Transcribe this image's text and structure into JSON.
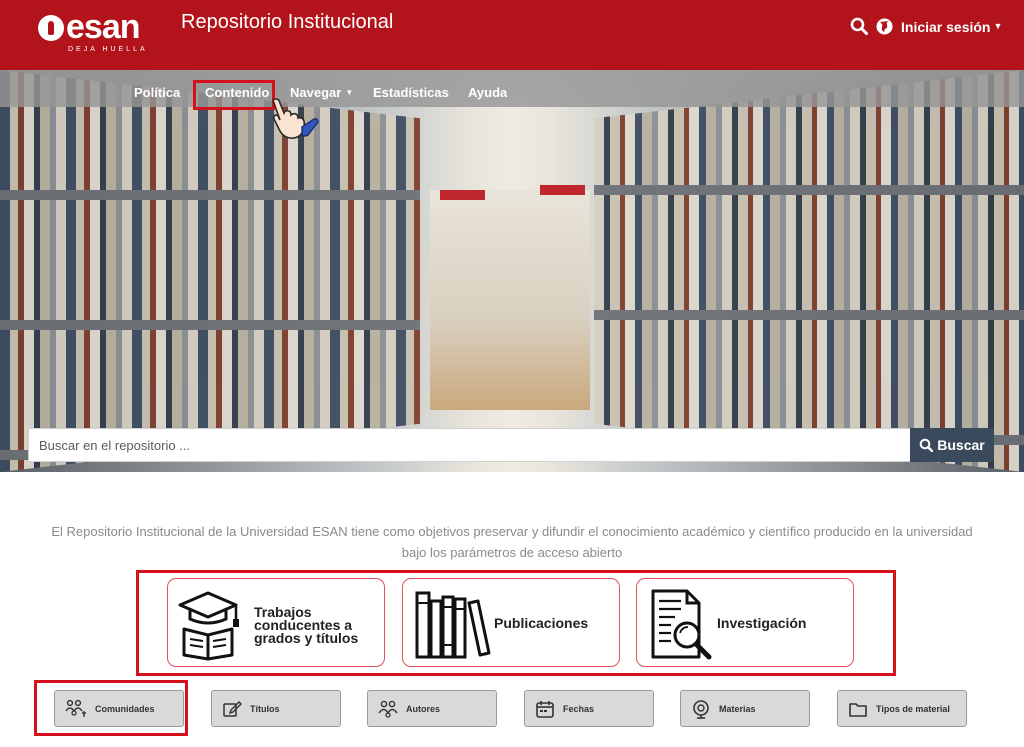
{
  "header": {
    "logo_text": "esan",
    "logo_tagline": "DEJA HUELLA",
    "title": "Repositorio Institucional",
    "login_label": "Iniciar sesión"
  },
  "nav": {
    "items": [
      {
        "label": "Política"
      },
      {
        "label": "Contenido"
      },
      {
        "label": "Navegar"
      },
      {
        "label": "Estadísticas"
      },
      {
        "label": "Ayuda"
      }
    ]
  },
  "search": {
    "placeholder": "Buscar en el repositorio ...",
    "button_label": "Buscar"
  },
  "description": "El Repositorio Institucional de la Universidad ESAN tiene como objetivos preservar y difundir el conocimiento académico y científico producido en la universidad bajo los parámetros de acceso abierto",
  "cards": [
    {
      "label_lines": [
        "Trabajos",
        "conducentes a",
        "grados y títulos"
      ]
    },
    {
      "label": "Publicaciones"
    },
    {
      "label": "Investigación"
    }
  ],
  "browse": [
    {
      "label": "Comunidades",
      "icon": "community-icon"
    },
    {
      "label": "Títulos",
      "icon": "edit-icon"
    },
    {
      "label": "Autores",
      "icon": "authors-icon"
    },
    {
      "label": "Fechas",
      "icon": "calendar-icon"
    },
    {
      "label": "Materias",
      "icon": "monitor-icon"
    },
    {
      "label": "Tipos de material",
      "icon": "folder-icon"
    }
  ],
  "colors": {
    "brand_red": "#b3141b",
    "highlight_red": "#d5121b",
    "search_button": "#3a4a5c"
  }
}
